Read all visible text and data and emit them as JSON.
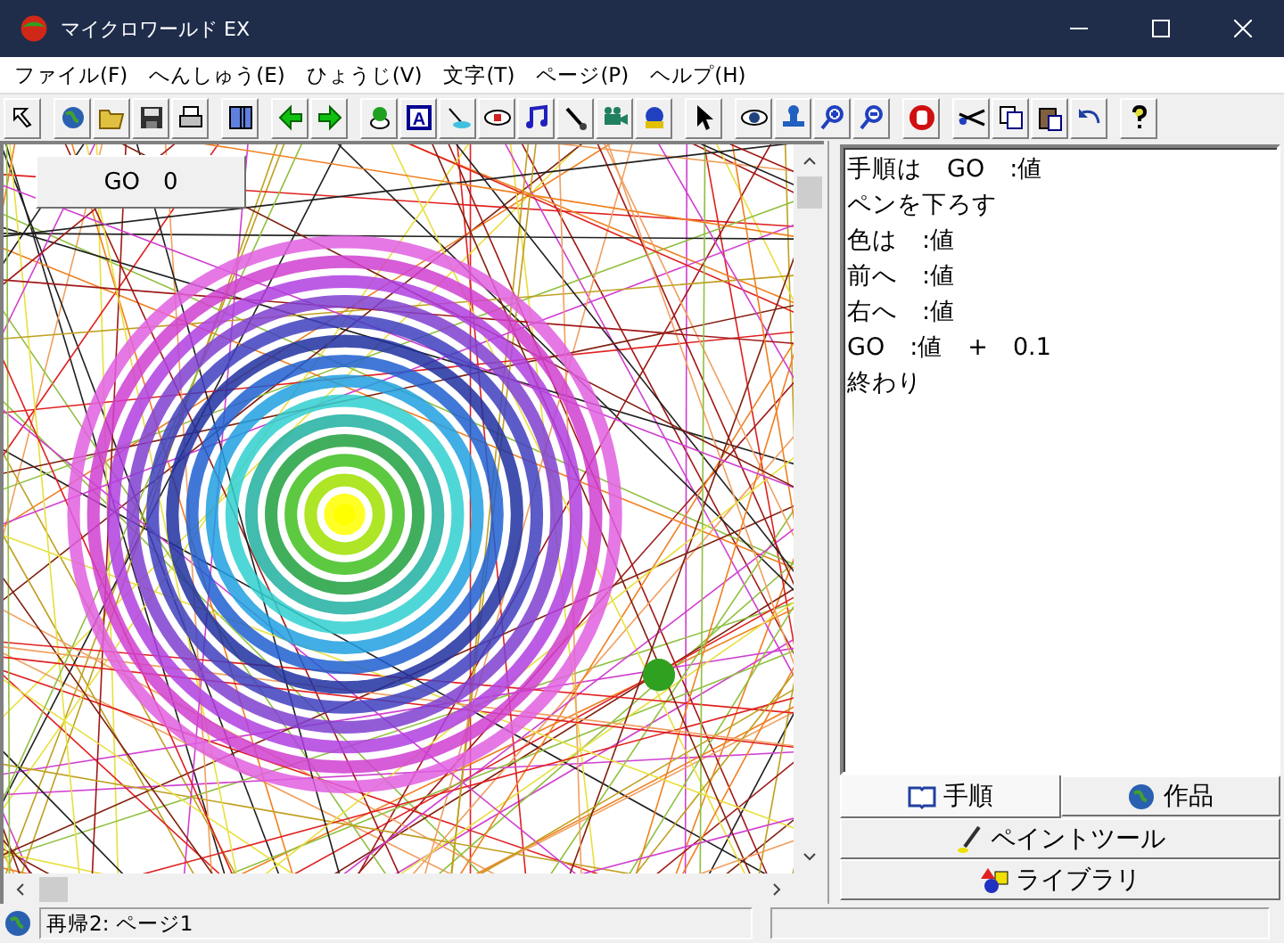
{
  "window": {
    "title": "マイクロワールド EX"
  },
  "menu": [
    "ファイル(F)",
    "へんしゅう(E)",
    "ひょうじ(V)",
    "文字(T)",
    "ページ(P)",
    "ヘルプ(H)"
  ],
  "toolbar": {
    "text_tool_letter": "A"
  },
  "canvas": {
    "button": "GO　0"
  },
  "procedure": {
    "lines": [
      "手順は　GO　:値",
      "ペンを下ろす",
      "色は　:値",
      "前へ　:値",
      "右へ　:値",
      "GO　:値　+　0.1",
      "終わり"
    ]
  },
  "tabs": [
    {
      "label": "手順",
      "selected": true,
      "kind": "book"
    },
    {
      "label": "作品",
      "selected": false,
      "kind": "globe"
    },
    {
      "label": "ペイントツール",
      "selected": false,
      "kind": "brush"
    },
    {
      "label": "ライブラリ",
      "selected": false,
      "kind": "shapes"
    }
  ],
  "status_bar": {
    "text": "再帰2:  ページ1"
  }
}
